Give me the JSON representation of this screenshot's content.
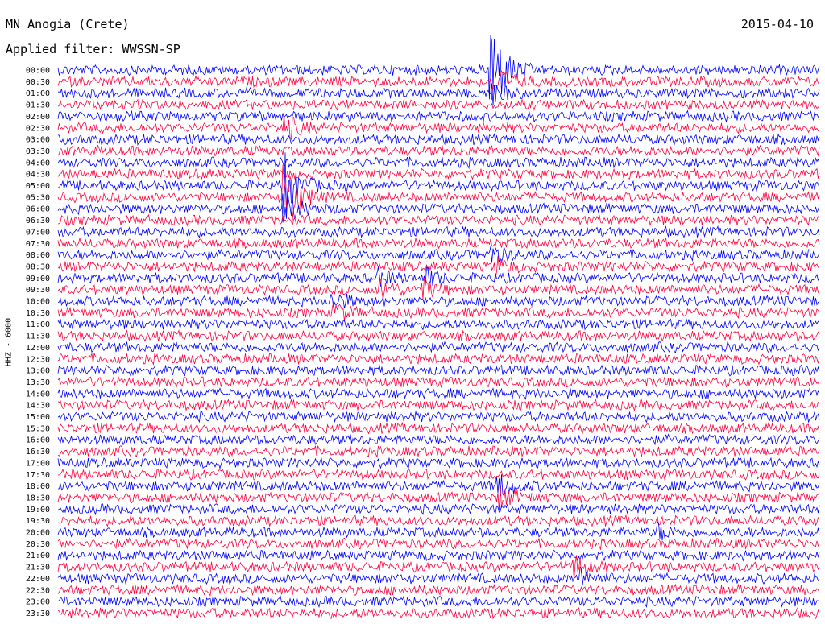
{
  "header": {
    "station": "MN Anogia (Crete)",
    "filter": "Applied filter: WWSSN-SP",
    "date": "2015-04-10"
  },
  "colors": {
    "trace_a": "#0000ff",
    "trace_b": "#ff0040",
    "background": "#ffffff",
    "text": "#000000"
  },
  "chart_data": {
    "type": "line",
    "title": "MN Anogia (Crete)",
    "subtitle": "Applied filter: WWSSN-SP",
    "ylabel": "HHZ - 6000",
    "xlabel": "",
    "grid": false,
    "series_color_pattern": [
      "#0000ff",
      "#ff0040"
    ],
    "y_tick_labels": [
      "00:00",
      "00:30",
      "01:00",
      "01:30",
      "02:00",
      "02:30",
      "03:00",
      "03:30",
      "04:00",
      "04:30",
      "05:00",
      "05:30",
      "06:00",
      "06:30",
      "07:00",
      "07:30",
      "08:00",
      "08:30",
      "09:00",
      "09:30",
      "10:00",
      "10:30",
      "11:00",
      "11:30",
      "12:00",
      "12:30",
      "13:00",
      "13:30",
      "14:00",
      "14:30",
      "15:00",
      "15:30",
      "16:00",
      "16:30",
      "17:00",
      "17:30",
      "18:00",
      "18:30",
      "19:00",
      "19:30",
      "20:00",
      "20:30",
      "21:00",
      "21:30",
      "22:00",
      "22:30",
      "23:00",
      "23:30"
    ],
    "x_range_minutes": [
      0,
      30
    ],
    "events": [
      {
        "row": 0,
        "minute": 17.0,
        "amplitude": 5.0
      },
      {
        "row": 1,
        "minute": 17.1,
        "amplitude": 1.5
      },
      {
        "row": 2,
        "minute": 17.1,
        "amplitude": 0.8
      },
      {
        "row": 5,
        "minute": 8.9,
        "amplitude": 1.0
      },
      {
        "row": 10,
        "minute": 8.9,
        "amplitude": 2.5
      },
      {
        "row": 11,
        "minute": 8.9,
        "amplitude": 3.5
      },
      {
        "row": 12,
        "minute": 8.9,
        "amplitude": 1.5
      },
      {
        "row": 16,
        "minute": 17.0,
        "amplitude": 0.8
      },
      {
        "row": 17,
        "minute": 17.2,
        "amplitude": 0.7
      },
      {
        "row": 18,
        "minute": 12.5,
        "amplitude": 0.6
      },
      {
        "row": 18,
        "minute": 14.5,
        "amplitude": 0.6
      },
      {
        "row": 19,
        "minute": 12.7,
        "amplitude": 0.8
      },
      {
        "row": 19,
        "minute": 14.3,
        "amplitude": 0.8
      },
      {
        "row": 20,
        "minute": 10.8,
        "amplitude": 0.7
      },
      {
        "row": 21,
        "minute": 10.9,
        "amplitude": 0.8
      },
      {
        "row": 36,
        "minute": 17.3,
        "amplitude": 1.0
      },
      {
        "row": 37,
        "minute": 17.4,
        "amplitude": 0.8
      },
      {
        "row": 40,
        "minute": 23.6,
        "amplitude": 0.6
      },
      {
        "row": 43,
        "minute": 20.3,
        "amplitude": 1.0
      },
      {
        "row": 44,
        "minute": 20.6,
        "amplitude": 0.6
      }
    ]
  }
}
